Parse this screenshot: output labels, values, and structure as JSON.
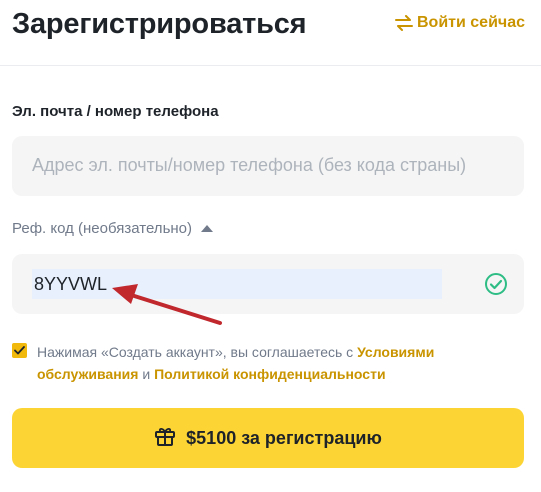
{
  "header": {
    "title": "Зарегистрироваться",
    "login_link": "Войти сейчас",
    "login_icon": "swap-arrows-icon"
  },
  "form": {
    "email_label": "Эл. почта / номер телефона",
    "email_placeholder": "Адрес эл. почты/номер телефона (без кода страны)",
    "ref_label": "Реф. код (необязательно)",
    "ref_value": "8YYVWL",
    "ref_status_icon": "check-circle-icon",
    "agree": {
      "prefix": "Нажимая «Создать аккаунт», вы соглашаетесь с",
      "terms_link": "Условиями обслуживания",
      "and": "и",
      "privacy_link": "Политикой конфиденциальности"
    },
    "submit_label": "$5100 за регистрацию",
    "submit_icon": "gift-icon"
  },
  "colors": {
    "accent": "#f0b90b",
    "link": "#c99400",
    "button": "#fcd535",
    "success": "#2ebd85",
    "annotation_arrow": "#c0282d"
  }
}
